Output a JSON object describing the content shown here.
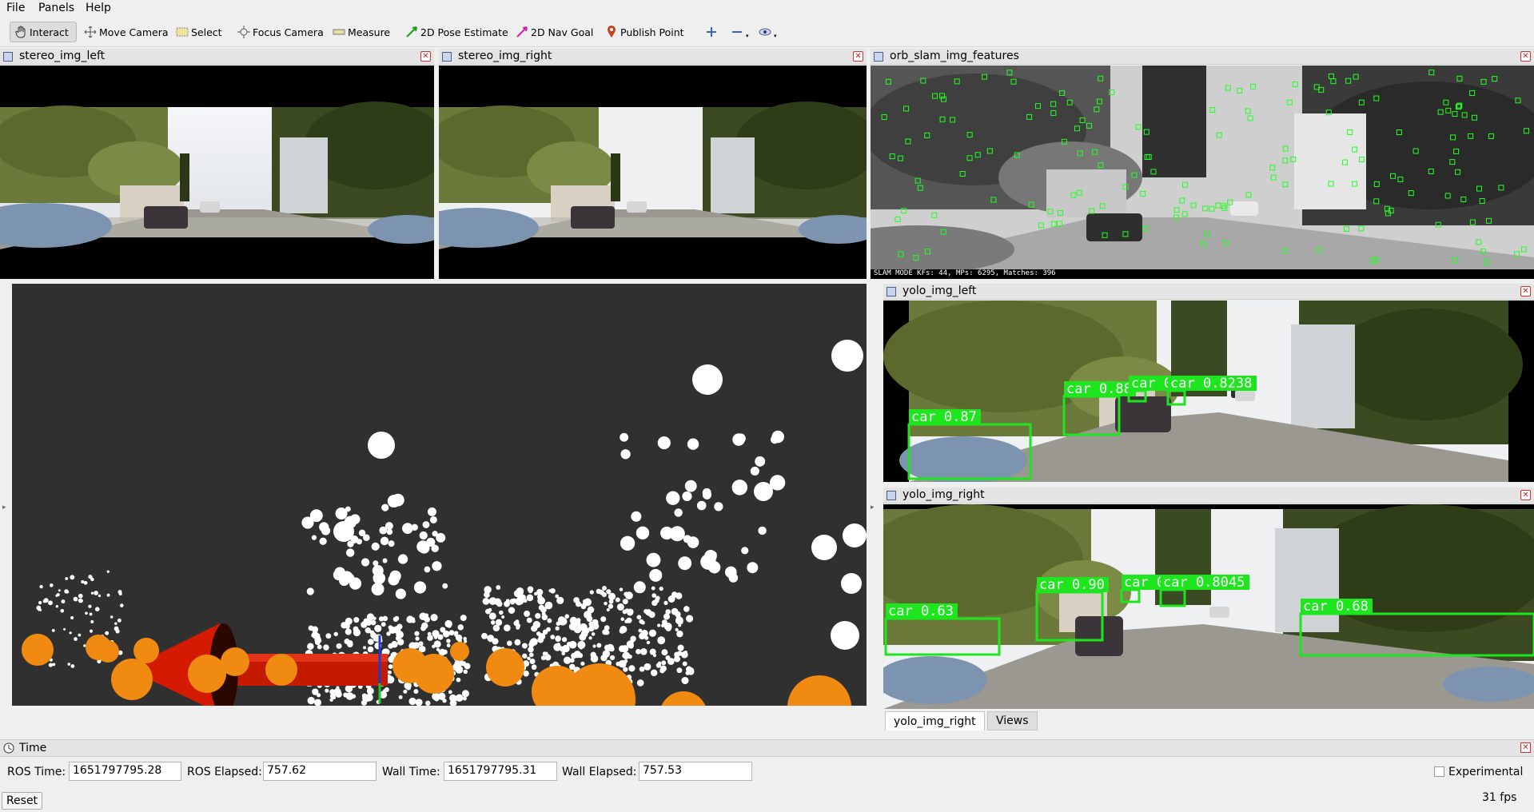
{
  "menu": {
    "file": "File",
    "panels": "Panels",
    "help": "Help"
  },
  "toolbar": {
    "interact": "Interact",
    "move_camera": "Move Camera",
    "select": "Select",
    "focus_camera": "Focus Camera",
    "measure": "Measure",
    "pose_estimate": "2D Pose Estimate",
    "nav_goal": "2D Nav Goal",
    "publish_point": "Publish Point"
  },
  "panels": {
    "stereo_left": {
      "title": "stereo_img_left"
    },
    "stereo_right": {
      "title": "stereo_img_right"
    },
    "orb_slam": {
      "title": "orb_slam_img_features",
      "status": "SLAM MODE  KFs: 44, MPs: 6295, Matches: 396"
    },
    "yolo_left": {
      "title": "yolo_img_left",
      "detections": [
        "car 0.87",
        "car 0.88",
        "car 0.",
        "car 0.8238"
      ]
    },
    "yolo_right": {
      "title": "yolo_img_right",
      "detections": [
        "car 0.63",
        "car 0.90",
        "car 0.",
        "car 0.8045",
        "car 0.68"
      ]
    }
  },
  "tabs": {
    "active": "yolo_img_right",
    "views": "Views"
  },
  "time": {
    "title": "Time",
    "ros_time_label": "ROS Time:",
    "ros_time": "1651797795.28",
    "ros_elapsed_label": "ROS Elapsed:",
    "ros_elapsed": "757.62",
    "wall_time_label": "Wall Time:",
    "wall_time": "1651797795.31",
    "wall_elapsed_label": "Wall Elapsed:",
    "wall_elapsed": "757.53",
    "experimental": "Experimental",
    "reset": "Reset",
    "fps": "31 fps"
  },
  "colors": {
    "detection_box": "#1ee61e",
    "orb_feature": "#22ff22",
    "pose_arrow": "#d41a00",
    "keyframe_sphere": "#f08a10",
    "map_point": "#ffffff",
    "view_background": "#303030"
  }
}
